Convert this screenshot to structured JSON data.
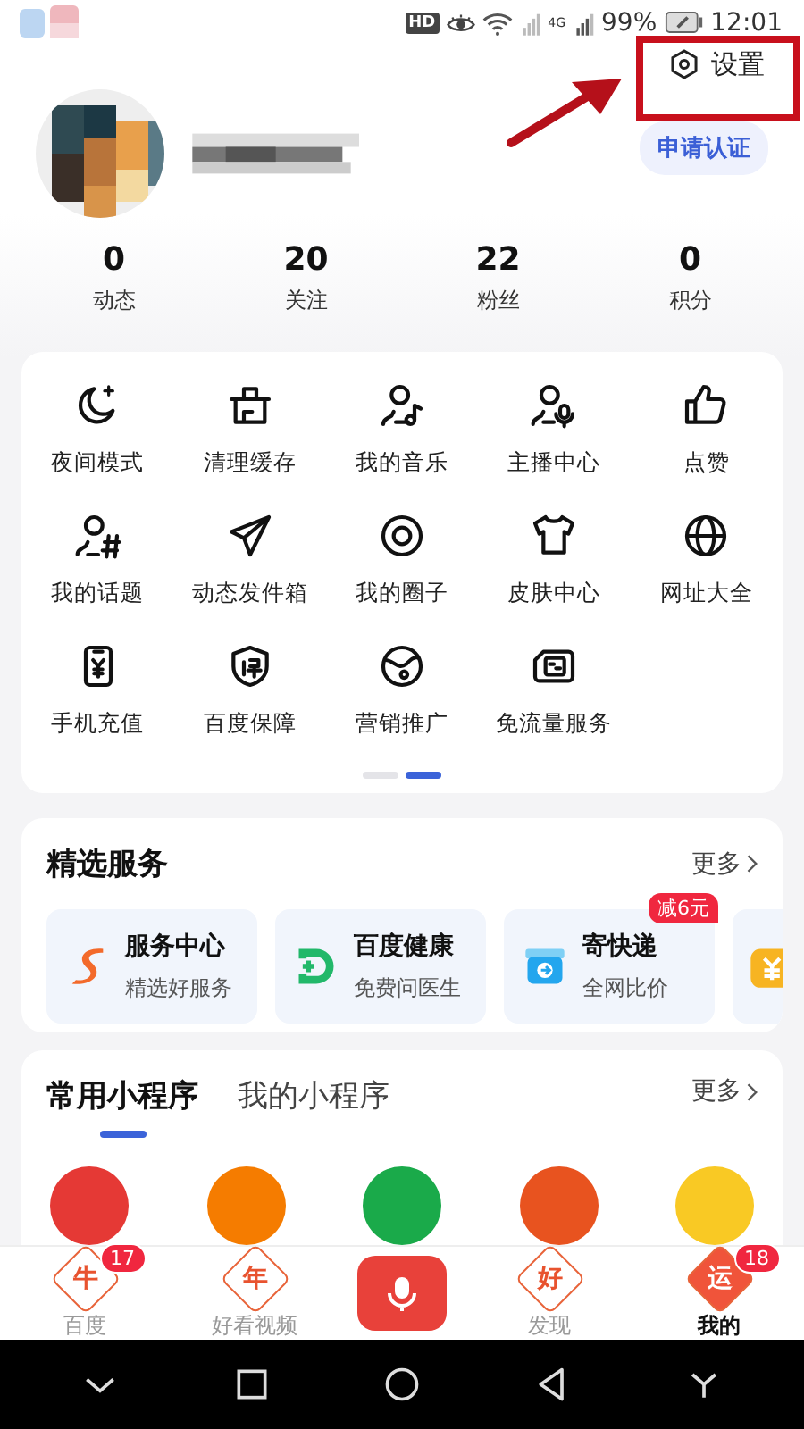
{
  "status_bar": {
    "hd_badge": "HD",
    "network": "4G",
    "battery": "99%",
    "time": "12:01"
  },
  "settings": {
    "label": "设置"
  },
  "profile": {
    "verify_button": "申请认证"
  },
  "stats": [
    {
      "value": "0",
      "label": "动态"
    },
    {
      "value": "20",
      "label": "关注"
    },
    {
      "value": "22",
      "label": "粉丝"
    },
    {
      "value": "0",
      "label": "积分"
    }
  ],
  "tools": {
    "items": [
      {
        "label": "夜间模式"
      },
      {
        "label": "清理缓存"
      },
      {
        "label": "我的音乐"
      },
      {
        "label": "主播中心"
      },
      {
        "label": "点赞"
      },
      {
        "label": "我的话题"
      },
      {
        "label": "动态发件箱"
      },
      {
        "label": "我的圈子"
      },
      {
        "label": "皮肤中心"
      },
      {
        "label": "网址大全"
      },
      {
        "label": "手机充值"
      },
      {
        "label": "百度保障"
      },
      {
        "label": "营销推广"
      },
      {
        "label": "免流量服务"
      }
    ],
    "pages": [
      {
        "selected": false
      },
      {
        "selected": true
      }
    ]
  },
  "featured": {
    "title": "精选服务",
    "more": "更多",
    "cards": [
      {
        "kind": "full",
        "title": "服务中心",
        "subtitle": "精选好服务"
      },
      {
        "kind": "full",
        "title": "百度健康",
        "subtitle": "免费问医生"
      },
      {
        "kind": "full",
        "title": "寄快递",
        "subtitle": "全网比价",
        "badge": "减6元"
      },
      {
        "kind": "partial"
      }
    ]
  },
  "mini_programs": {
    "tabs": [
      {
        "label": "常用小程序",
        "selected": true
      },
      {
        "label": "我的小程序",
        "selected": false
      }
    ],
    "more": "更多",
    "apps": [
      {
        "color": "#e53935"
      },
      {
        "color": "#f57c00"
      },
      {
        "color": "#1aaa4a"
      },
      {
        "color": "#e8531f"
      },
      {
        "color": "#f9c924"
      }
    ]
  },
  "tab_bar": [
    {
      "kind": "tab",
      "label": "百度",
      "icon_text": "牛",
      "badge": "17",
      "selected": false
    },
    {
      "kind": "tab",
      "label": "好看视频",
      "icon_text": "年",
      "selected": false
    },
    {
      "kind": "voice"
    },
    {
      "kind": "tab",
      "label": "发现",
      "icon_text": "好",
      "selected": false
    },
    {
      "kind": "tab",
      "label": "我的",
      "icon_text": "运",
      "badge": "18",
      "selected": true
    }
  ]
}
